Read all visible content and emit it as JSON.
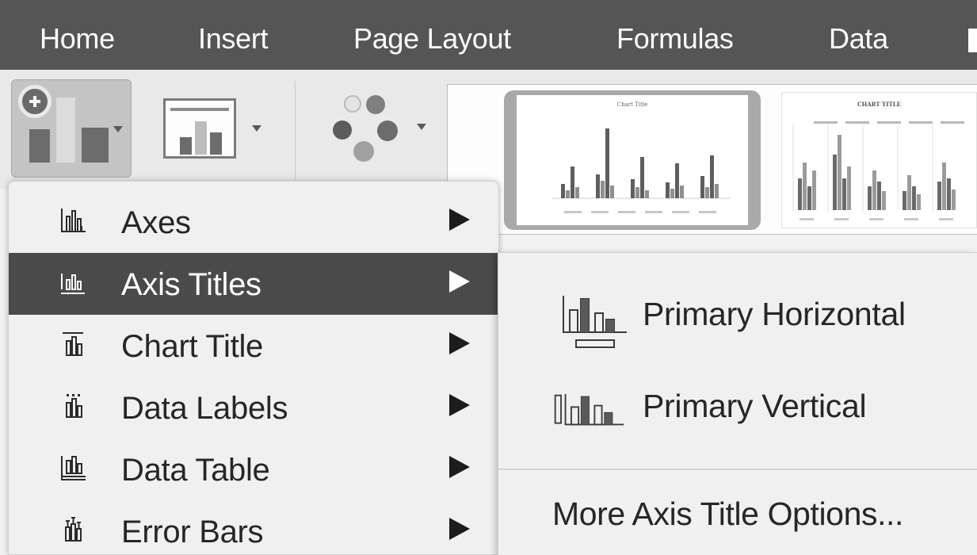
{
  "ribbon": {
    "tabs": [
      "Home",
      "Insert",
      "Page Layout",
      "Formulas",
      "Data"
    ],
    "gallery": {
      "thumbnail_1_title": "Chart Title",
      "thumbnail_2_title": "CHART TITLE"
    }
  },
  "menu": {
    "items": [
      {
        "label": "Axes",
        "icon": "axes-icon"
      },
      {
        "label": "Axis Titles",
        "icon": "axis-titles-icon"
      },
      {
        "label": "Chart Title",
        "icon": "chart-title-icon"
      },
      {
        "label": "Data Labels",
        "icon": "data-labels-icon"
      },
      {
        "label": "Data Table",
        "icon": "data-table-icon"
      },
      {
        "label": "Error Bars",
        "icon": "error-bars-icon"
      }
    ],
    "active_index": 1
  },
  "submenu": {
    "items": [
      {
        "label": "Primary Horizontal",
        "icon": "primary-horizontal-axis-title-icon"
      },
      {
        "label": "Primary Vertical",
        "icon": "primary-vertical-axis-title-icon"
      }
    ],
    "more_label": "More Axis Title Options..."
  },
  "colors": {
    "tab_bar": "#555555",
    "active_item": "#4a4a4a",
    "menu_background": "#f0f0f0"
  }
}
